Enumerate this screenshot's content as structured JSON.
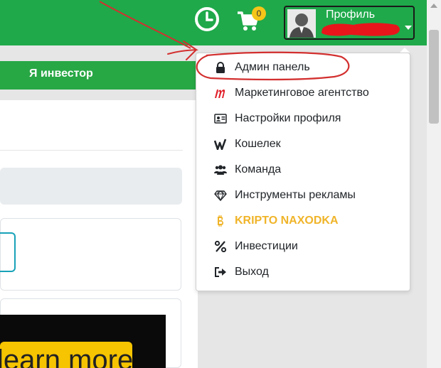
{
  "header": {
    "cart_count": "0",
    "profile_label": "Профиль"
  },
  "nav": {
    "investor_label": "Я инвестор"
  },
  "dropdown": {
    "items": [
      {
        "label": "Админ панель",
        "icon": "lock-icon"
      },
      {
        "label": "Маркетинговое агентство",
        "icon": "m-logo-icon"
      },
      {
        "label": "Настройки профиля",
        "icon": "id-card-icon"
      },
      {
        "label": "Кошелек",
        "icon": "wallet-logo-icon"
      },
      {
        "label": "Команда",
        "icon": "users-icon"
      },
      {
        "label": "Инструменты рекламы",
        "icon": "diamond-icon"
      },
      {
        "label": "KRIPTO NAXODKA",
        "icon": "bitcoin-icon"
      },
      {
        "label": "Инвестиции",
        "icon": "percent-icon"
      },
      {
        "label": "Выход",
        "icon": "sign-out-icon"
      }
    ]
  },
  "banner": {
    "text": "learn more"
  },
  "colors": {
    "brand_green": "#1fa94a",
    "nav_green": "#28a745",
    "kripto_gold": "#f0b429",
    "annotation_red": "#d32f2f"
  }
}
